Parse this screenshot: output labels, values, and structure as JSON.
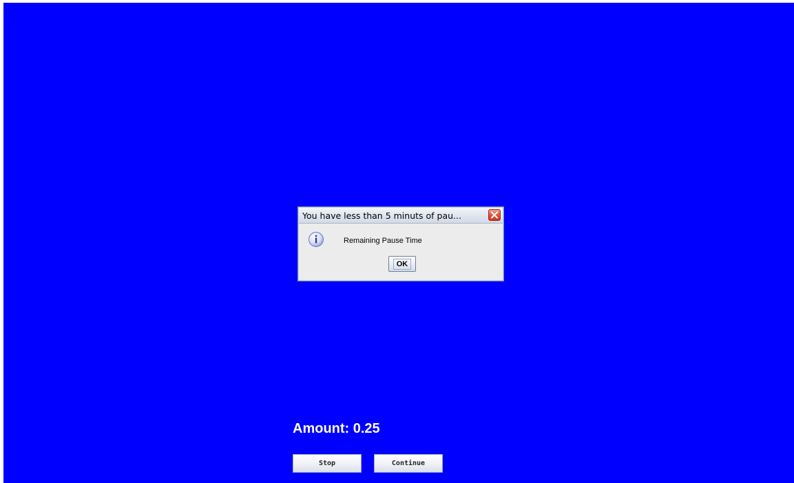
{
  "dialog": {
    "title": "You have less than 5 minuts of pau...",
    "message": "Remaining Pause Time",
    "ok_label": "OK",
    "icon": "info-icon",
    "close_icon": "close-icon"
  },
  "main": {
    "amount_text": "Amount: 0.25",
    "stop_label": "Stop",
    "continue_label": "Continue"
  },
  "colors": {
    "background": "#0000ff",
    "text": "#ffffff"
  }
}
